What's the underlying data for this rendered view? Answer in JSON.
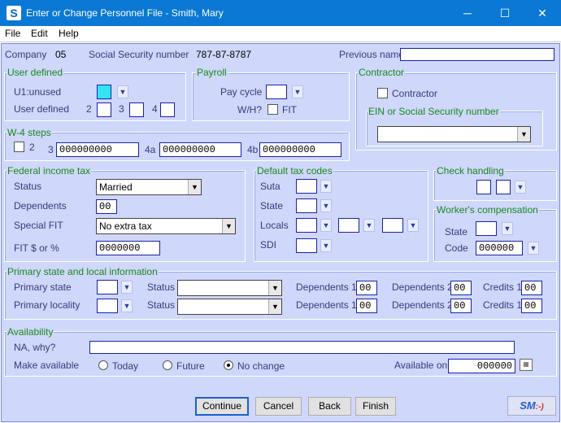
{
  "window": {
    "title": "Enter or Change Personnel File - Smith, Mary",
    "icon_letter": "S",
    "min": "─",
    "max": "☐",
    "close": "✕"
  },
  "menu": {
    "file": "File",
    "edit": "Edit",
    "help": "Help"
  },
  "header": {
    "company_label": "Company",
    "company_value": "05",
    "ssn_label": "Social Security number",
    "ssn_value": "787-87-8787",
    "previous_name_label": "Previous name",
    "previous_name_value": ""
  },
  "user_defined": {
    "title": "User defined",
    "u1_label": "U1:unused",
    "ud_label": "User defined",
    "n2": "2",
    "n3": "3",
    "n4": "4"
  },
  "payroll": {
    "title": "Payroll",
    "pay_cycle_label": "Pay cycle",
    "wh_label": "W/H?",
    "fit_label": "FIT"
  },
  "contractor": {
    "title": "Contractor",
    "contractor_label": "Contractor",
    "ein_title": "EIN or Social Security number",
    "ein_value": ""
  },
  "w4": {
    "title": "W-4 steps",
    "n2": "2",
    "n3": "3",
    "v3": "000000000",
    "n4a": "4a",
    "v4a": "000000000",
    "n4b": "4b",
    "v4b": "000000000"
  },
  "federal": {
    "title": "Federal income tax",
    "status_label": "Status",
    "status_value": "Married",
    "dependents_label": "Dependents",
    "dependents_value": "00",
    "special_fit_label": "Special FIT",
    "special_fit_value": "No extra tax",
    "fit_label": "FIT $ or %",
    "fit_value": "0000000"
  },
  "default_tax": {
    "title": "Default tax codes",
    "suta": "Suta",
    "state": "State",
    "locals": "Locals",
    "sdi": "SDI"
  },
  "check_handling": {
    "title": "Check handling"
  },
  "workers_comp": {
    "title": "Worker's compensation",
    "state_label": "State",
    "code_label": "Code",
    "code_value": "000000"
  },
  "primary": {
    "title": "Primary state and local information",
    "state_label": "Primary state",
    "locality_label": "Primary locality",
    "status_label": "Status",
    "dep1_label": "Dependents 1",
    "dep2_label": "Dependents 2",
    "cred1_label": "Credits 1",
    "row1": {
      "dep1": "00",
      "dep2": "00",
      "cred1": "00"
    },
    "row2": {
      "dep1": "00",
      "dep2": "00",
      "cred1": "00"
    }
  },
  "availability": {
    "title": "Availability",
    "na_label": "NA, why?",
    "na_value": "",
    "make_available_label": "Make available",
    "opt_today": "Today",
    "opt_future": "Future",
    "opt_nochange": "No change",
    "selected": "No change",
    "available_on_label": "Available on",
    "available_on_value": "000000"
  },
  "buttons": {
    "continue": "Continue",
    "cancel": "Cancel",
    "back": "Back",
    "finish": "Finish",
    "sm_main": "SM",
    "sm_face": ":-)"
  },
  "colors": {
    "titlebar": "#0a78d4",
    "panel": "#cfd7fb",
    "group_title": "#1a8a1a",
    "field_border": "#1a22a8",
    "u1_field": "#33e5f2"
  }
}
